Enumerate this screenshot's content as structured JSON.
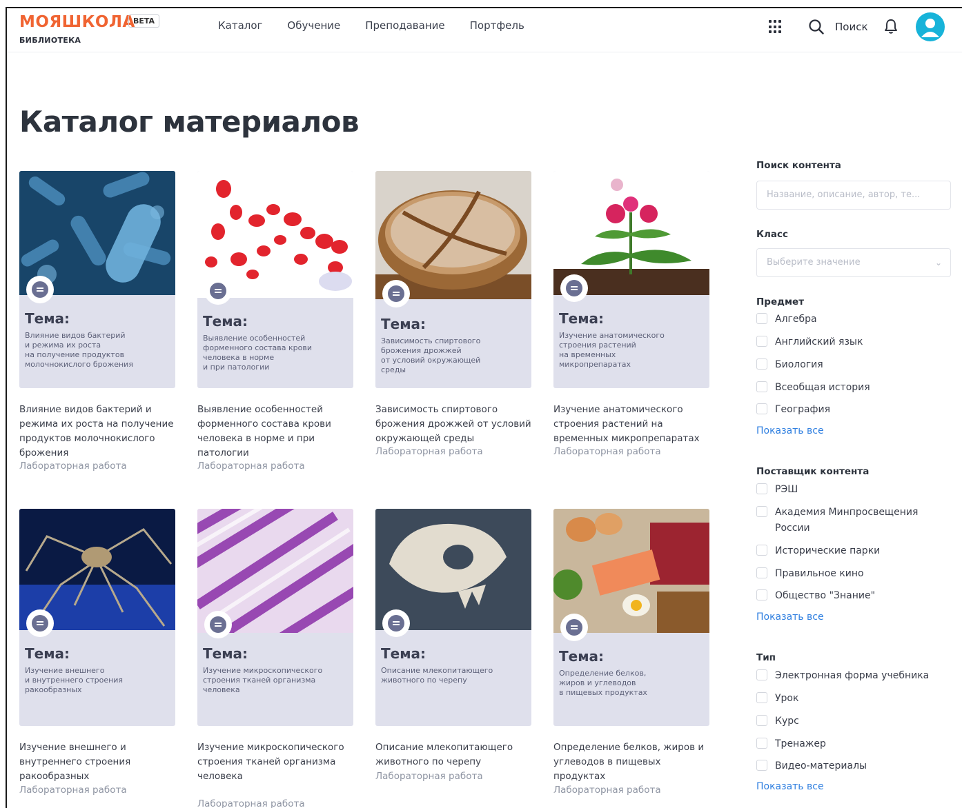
{
  "header": {
    "logo": "МОЯШКОЛА",
    "beta": "BETA",
    "sublogo": "БИБЛИОТЕКА",
    "nav": [
      "Каталог",
      "Обучение",
      "Преподавание",
      "Портфель"
    ],
    "search_label": "Поиск"
  },
  "page_title": "Каталог материалов",
  "cards": [
    {
      "tema": "Тема:",
      "tema_desc": "Влияние видов бактерий\nи режима их роста\nна получение продуктов\nмолочнокислого брожения",
      "title": "Влияние видов бактерий и режима их роста на получение продуктов молочнокислого брожения",
      "type": "Лабораторная работа"
    },
    {
      "tema": "Тема:",
      "tema_desc": "Выявление особенностей\nформенного состава крови\nчеловека в норме\nи при патологии",
      "title": "Выявление особенностей форменного состава крови человека в норме и при патологии",
      "type": "Лабораторная работа"
    },
    {
      "tema": "Тема:",
      "tema_desc": "Зависимость спиртового\nброжения дрожжей\nот условий окружающей\nсреды",
      "title": "Зависимость спиртового брожения дрожжей от условий окружающей среды",
      "type": "Лабораторная работа"
    },
    {
      "tema": "Тема:",
      "tema_desc": "Изучение анатомического\nстроения растений\nна временных\nмикропрепаратах",
      "title": "Изучение анатомического строения растений на временных микропрепаратах",
      "type": "Лабораторная работа"
    },
    {
      "tema": "Тема:",
      "tema_desc": "Изучение внешнего\nи внутреннего строения\nракообразных",
      "title": "Изучение внешнего и внутреннего строения ракообразных",
      "type": "Лабораторная работа"
    },
    {
      "tema": "Тема:",
      "tema_desc": "Изучение микроскопического\nстроения тканей организма\nчеловека",
      "title": "Изучение микроскопического строения тканей организма человека",
      "type": "Лабораторная работа"
    },
    {
      "tema": "Тема:",
      "tema_desc": "Описание млекопитающего\nживотного по черепу",
      "title": "Описание млекопитающего животного по черепу",
      "type": "Лабораторная работа"
    },
    {
      "tema": "Тема:",
      "tema_desc": "Определение белков,\nжиров и углеводов\nв пищевых продуктах",
      "title": "Определение белков, жиров и углеводов в пищевых продуктах",
      "type": "Лабораторная работа"
    }
  ],
  "sidebar": {
    "search_title": "Поиск контента",
    "search_placeholder": "Название, описание, автор, те...",
    "class_title": "Класс",
    "class_placeholder": "Выберите значение",
    "subject_title": "Предмет",
    "subjects": [
      "Алгебра",
      "Английский язык",
      "Биология",
      "Всеобщая история",
      "География"
    ],
    "provider_title": "Поставщик контента",
    "providers": [
      "РЭШ",
      "Академия Минпросвещения России",
      "Исторические парки",
      "Правильное кино",
      "Общество \"Знание\""
    ],
    "type_title": "Тип",
    "types": [
      "Электронная форма учебника",
      "Урок",
      "Курс",
      "Тренажер",
      "Видео-материалы"
    ],
    "show_all": "Показать все"
  },
  "colors": {
    "brand": "#f06432",
    "link": "#2f7fe0",
    "avatar": "#17b3d9",
    "card_bg": "#dfe0ec"
  }
}
